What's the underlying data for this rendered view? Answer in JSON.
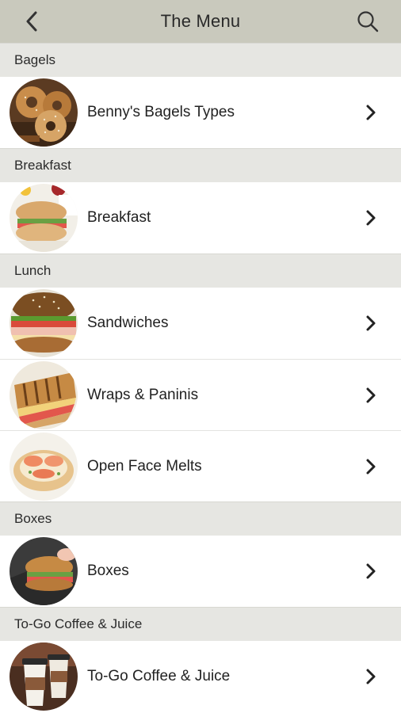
{
  "header": {
    "title": "The Menu",
    "back_icon": "chevron-left-icon",
    "search_icon": "search-icon",
    "background": "#c9c9bd"
  },
  "sections": [
    {
      "title": "Bagels",
      "items": [
        {
          "label": "Benny's Bagels Types",
          "image": "bagels-photo"
        }
      ]
    },
    {
      "title": "Breakfast",
      "items": [
        {
          "label": "Breakfast",
          "image": "breakfast-photo"
        }
      ]
    },
    {
      "title": "Lunch",
      "items": [
        {
          "label": "Sandwiches",
          "image": "sandwich-photo"
        },
        {
          "label": "Wraps & Paninis",
          "image": "panini-photo"
        },
        {
          "label": "Open Face Melts",
          "image": "melt-photo"
        }
      ]
    },
    {
      "title": "Boxes",
      "items": [
        {
          "label": "Boxes",
          "image": "box-sandwich-photo"
        }
      ]
    },
    {
      "title": "To-Go Coffee & Juice",
      "items": [
        {
          "label": "To-Go Coffee & Juice",
          "image": "coffee-cups-photo"
        }
      ]
    }
  ],
  "row_icon": "chevron-right-icon"
}
